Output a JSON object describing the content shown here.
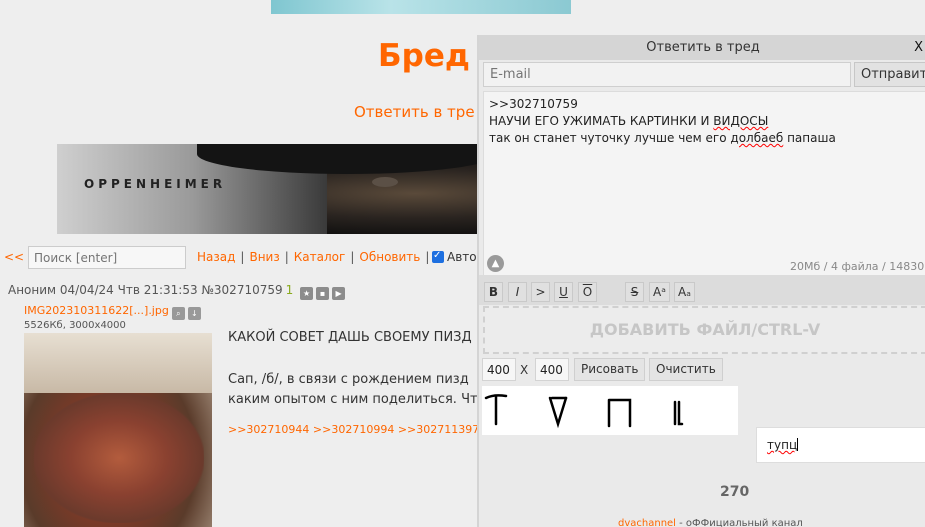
{
  "board": {
    "title": "Бред",
    "reply_link": "Ответить в тре",
    "banner_caption": "OPPENHEIMER"
  },
  "nav": {
    "back": "<<",
    "search_placeholder": "Поиск [enter]",
    "links": [
      "Назад",
      "Вниз",
      "Каталог",
      "Обновить"
    ],
    "separator": "|",
    "auto_label": "Авто"
  },
  "post": {
    "header": "Аноним 04/04/24 Чтв 21:31:53 №302710759",
    "reply_count": "1",
    "file_name": "IMG202310311622[...].jpg",
    "file_meta": "5526Кб, 3000x4000",
    "subject": "КАКОЙ СОВЕТ ДАШЬ СВОЕМУ ПИЗД",
    "body_lines": [
      "Сап, /б/, в связи с рождением пизд",
      "каким опытом с ним поделиться. Чт"
    ],
    "replies": ">>302710944 >>302710994 >>302711397"
  },
  "reply_form": {
    "title": "Ответить в тред",
    "close": "X",
    "email_placeholder": "E-mail",
    "send_label": "Отправить",
    "message_lines": [
      ">>302710759",
      "НАУЧИ ЕГО УЖИМАТЬ КАРТИНКИ И ВИДОСЫ",
      "так он станет чуточку лучше чем его долбаеб папаша"
    ],
    "msg2_prefix": "НАУЧИ ЕГО УЖИМАТЬ КАРТИНКИ И ",
    "msg2_underlined": "ВИДОСЫ",
    "msg3_prefix": "так он станет чуточку лучше чем его ",
    "msg3_underlined": "долбаеб",
    "msg3_suffix": " папаша",
    "limits": "20Мб / 4 файла / 14830",
    "format_buttons": [
      "B",
      "I",
      ">",
      "U",
      "O",
      "S",
      "Aᵃ",
      "Aₐ"
    ],
    "drop_zone": "ДОБАВИТЬ ФАЙЛ/CTRL-V",
    "width_value": "400",
    "x_label": "X",
    "height_value": "400",
    "draw_label": "Рисовать",
    "clear_label": "Очистить",
    "captcha_value": "тупц",
    "counter": "270",
    "channel_link": "dvachannel",
    "channel_text": " - оФФициальный канал"
  },
  "colors": {
    "accent": "#ff6600",
    "background": "#eeeeee",
    "count": "#8aaa1e"
  }
}
